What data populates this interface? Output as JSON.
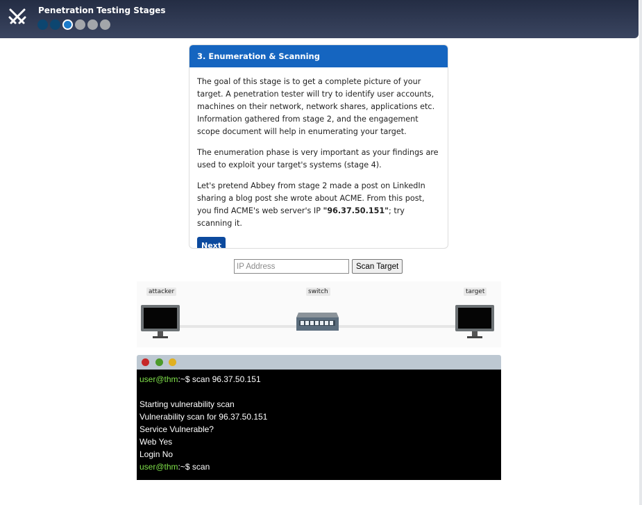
{
  "header": {
    "title": "Penetration Testing Stages",
    "stages": [
      "done",
      "done",
      "current",
      "todo",
      "todo",
      "todo"
    ]
  },
  "card": {
    "title": "3. Enumeration & Scanning",
    "p1": "The goal of this stage is to get a complete picture of your target. A penetration tester will try to identify user accounts, machines on their network, network shares, applications etc. Information gathered from stage 2, and the engagement scope document will help in enumerating your target.",
    "p2": "The enumeration phase is very important as your findings are used to exploit your target's systems (stage 4).",
    "p3_before": "Let's pretend Abbey from stage 2 made a post on LinkedIn sharing a blog post she wrote about ACME. From this post, you find ACME's web server's IP ",
    "p3_ip": "\"96.37.50.151\"",
    "p3_after": "; try scanning it.",
    "next_label": "Next"
  },
  "scan": {
    "placeholder": "IP Address",
    "button_label": "Scan Target"
  },
  "network": {
    "attacker_label": "attacker",
    "switch_label": "switch",
    "target_label": "target"
  },
  "terminal": {
    "user": "user@thm",
    "prompt_suffix": ":~$ ",
    "cmd1": "scan 96.37.50.151",
    "out1": "Starting vulnerability scan",
    "out2": "Vulnerability scan for 96.37.50.151",
    "out3": "Service Vulnerable?",
    "out4": "Web Yes",
    "out5": "Login No",
    "cmd2": "scan"
  },
  "colors": {
    "accent": "#1565c0",
    "terminal_user": "#7fe04a",
    "close": "#c62828",
    "minimize": "#4c9a2a",
    "maximize": "#e0b020"
  }
}
